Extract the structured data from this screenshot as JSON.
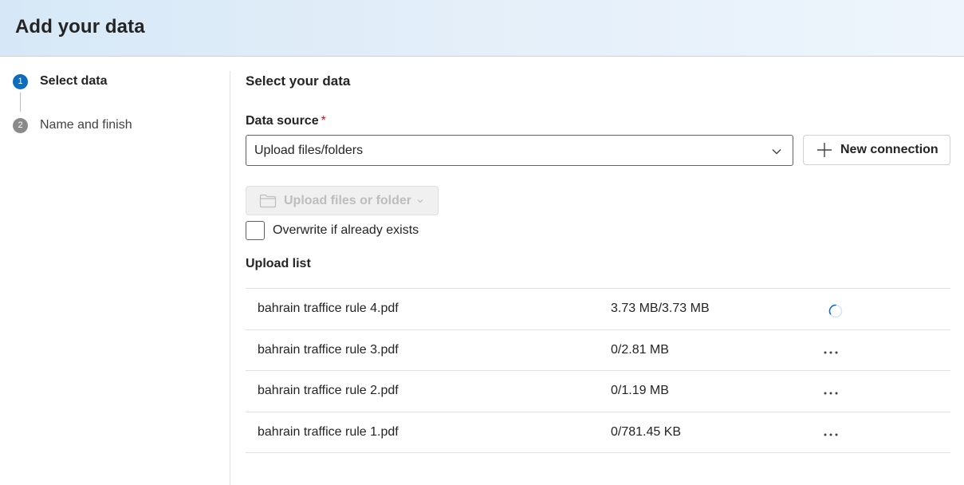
{
  "header": {
    "title": "Add your data"
  },
  "stepper": {
    "steps": [
      {
        "num": "1",
        "label": "Select data",
        "state": "active"
      },
      {
        "num": "2",
        "label": "Name and finish",
        "state": "inactive"
      }
    ]
  },
  "main": {
    "section_title": "Select your data",
    "data_source": {
      "label": "Data source",
      "required_mark": "*",
      "selected": "Upload files/folders"
    },
    "new_connection_label": "New connection",
    "upload_button_label": "Upload files or folder",
    "overwrite": {
      "label": "Overwrite if already exists",
      "checked": false
    },
    "upload_list": {
      "title": "Upload list",
      "rows": [
        {
          "name": "bahrain traffice rule 4.pdf",
          "size": "3.73 MB/3.73 MB",
          "status": "uploading"
        },
        {
          "name": "bahrain traffice rule 3.pdf",
          "size": "0/2.81 MB",
          "status": "more"
        },
        {
          "name": "bahrain traffice rule 2.pdf",
          "size": "0/1.19 MB",
          "status": "more"
        },
        {
          "name": "bahrain traffice rule 1.pdf",
          "size": "0/781.45 KB",
          "status": "more"
        }
      ]
    }
  },
  "colors": {
    "accent": "#0f6cbd",
    "required": "#c50f1f",
    "header_gradient_start": "#d6e8f7",
    "header_gradient_end": "#eef5fc"
  },
  "icons": {
    "dropdown": "chevron-down-icon",
    "new_connection": "plus-icon",
    "upload": "folder-icon",
    "row_actions": "more-horizontal-icon",
    "row_progress": "spinner-icon"
  }
}
